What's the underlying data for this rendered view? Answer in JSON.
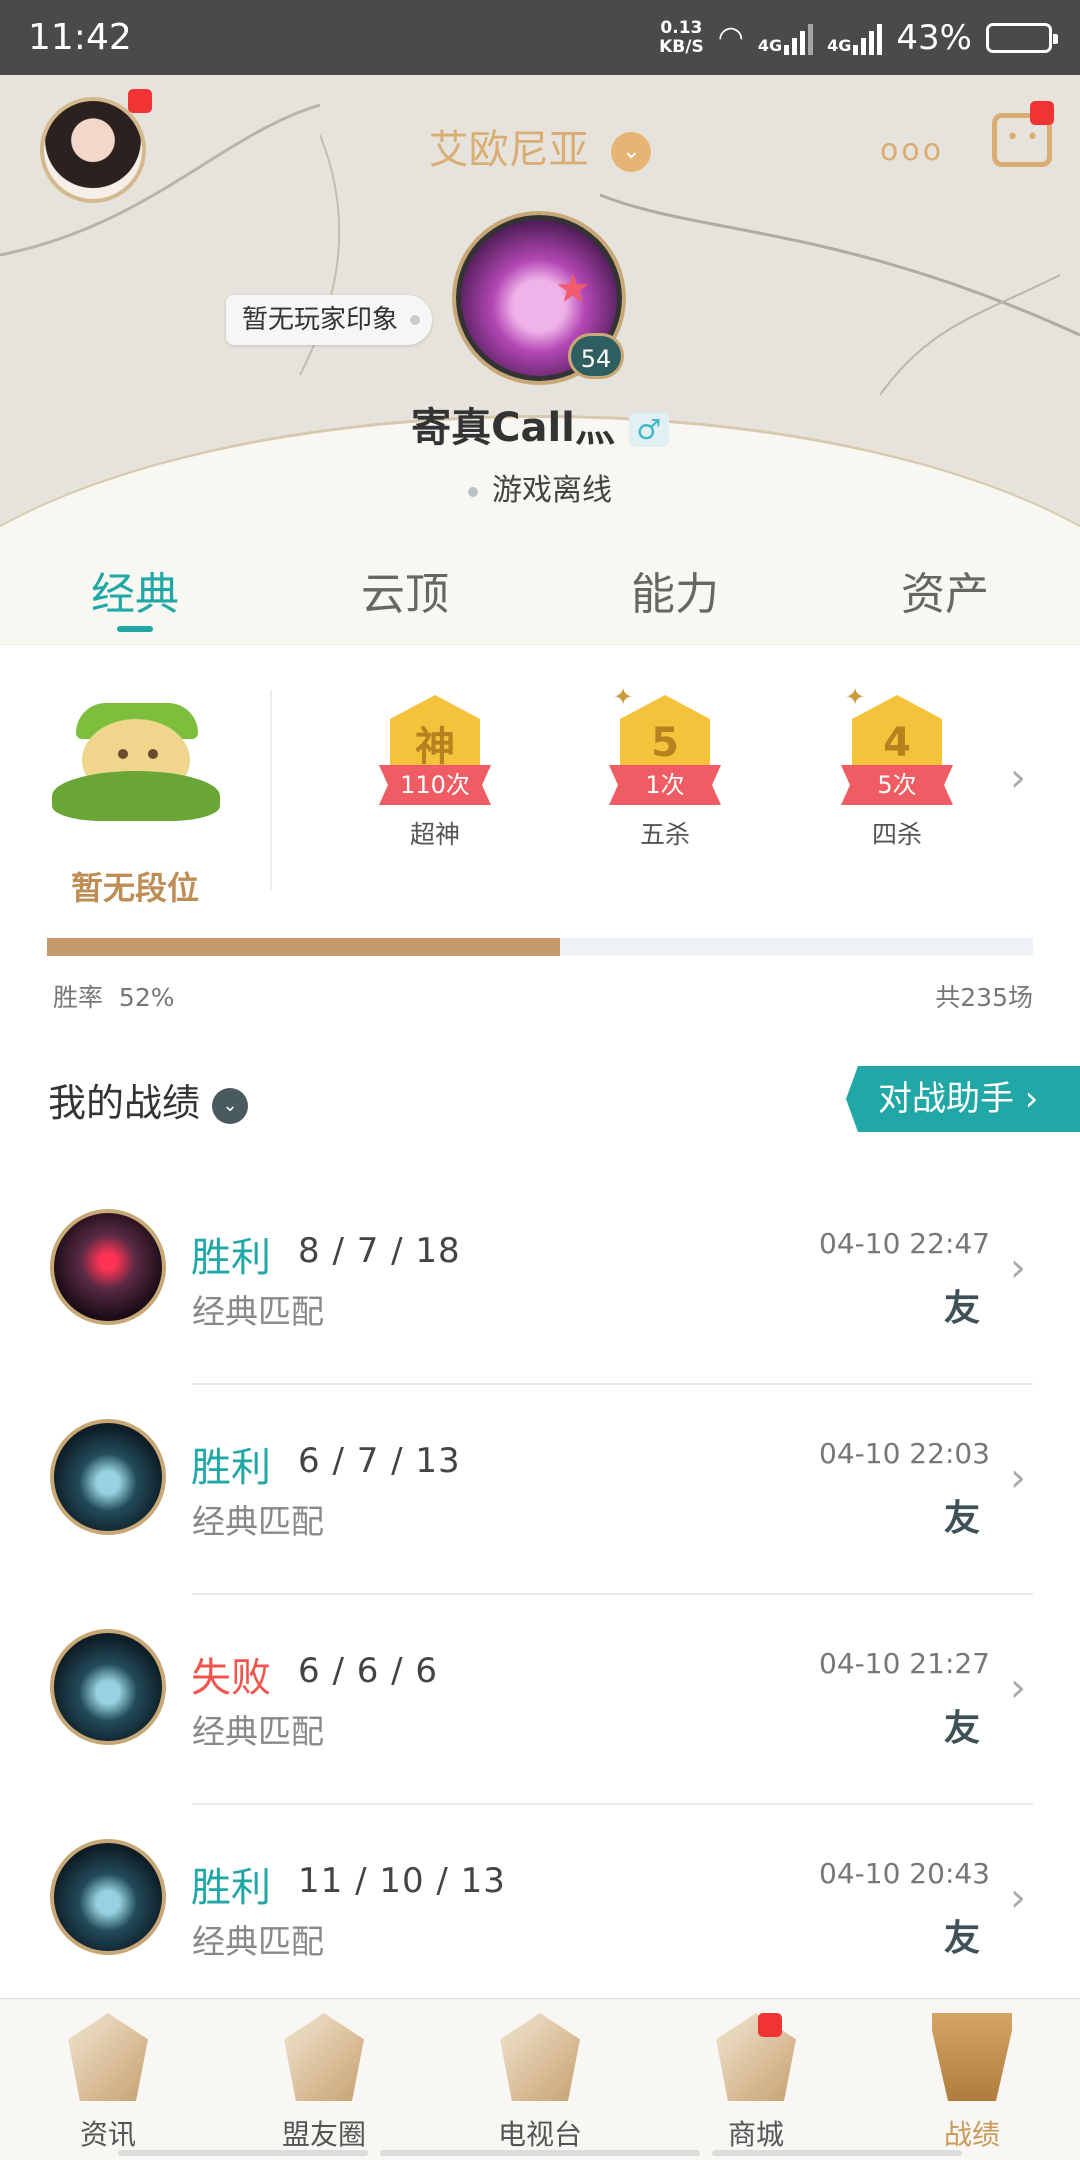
{
  "status_bar": {
    "time": "11:42",
    "net_speed_value": "0.13",
    "net_speed_unit": "KB/S",
    "signal_1": "4G",
    "signal_2": "4G",
    "battery": "43%"
  },
  "header": {
    "server": "艾欧尼亚",
    "impression": "暂无玩家印象",
    "level": "54",
    "player_name": "寄真Call灬",
    "gender_symbol": "♂",
    "status": "游戏离线"
  },
  "tabs": [
    {
      "label": "经典",
      "active": true
    },
    {
      "label": "云顶",
      "active": false
    },
    {
      "label": "能力",
      "active": false
    },
    {
      "label": "资产",
      "active": false
    }
  ],
  "rank": {
    "label": "暂无段位",
    "medals": [
      {
        "glyph": "神",
        "count": "110次",
        "name": "超神"
      },
      {
        "glyph": "5",
        "count": "1次",
        "name": "五杀"
      },
      {
        "glyph": "4",
        "count": "5次",
        "name": "四杀"
      }
    ],
    "win_fraction": 0.52,
    "winrate_label": "胜率",
    "winrate_value": "52%",
    "total_games": "共235场"
  },
  "record": {
    "title": "我的战绩",
    "assistant_label": "对战助手 ›"
  },
  "matches": [
    {
      "result": "胜利",
      "win": true,
      "kda": "8 / 7 / 18",
      "mode": "经典匹配",
      "time": "04-10 22:47",
      "badge": "友"
    },
    {
      "result": "胜利",
      "win": true,
      "kda": "6 / 7 / 13",
      "mode": "经典匹配",
      "time": "04-10 22:03",
      "badge": "友"
    },
    {
      "result": "失败",
      "win": false,
      "kda": "6 / 6 / 6",
      "mode": "经典匹配",
      "time": "04-10 21:27",
      "badge": "友"
    },
    {
      "result": "胜利",
      "win": true,
      "kda": "11 / 10 / 13",
      "mode": "经典匹配",
      "time": "04-10 20:43",
      "badge": "友"
    }
  ],
  "bottom_nav": [
    {
      "label": "资讯",
      "active": false
    },
    {
      "label": "盟友圈",
      "active": false
    },
    {
      "label": "电视台",
      "active": false
    },
    {
      "label": "商城",
      "active": false
    },
    {
      "label": "战绩",
      "active": true
    }
  ],
  "colors": {
    "accent_teal": "#21a7a6",
    "lose_red": "#f0554d",
    "gold": "#d9ad74",
    "progress_gold": "#c59a6a"
  }
}
